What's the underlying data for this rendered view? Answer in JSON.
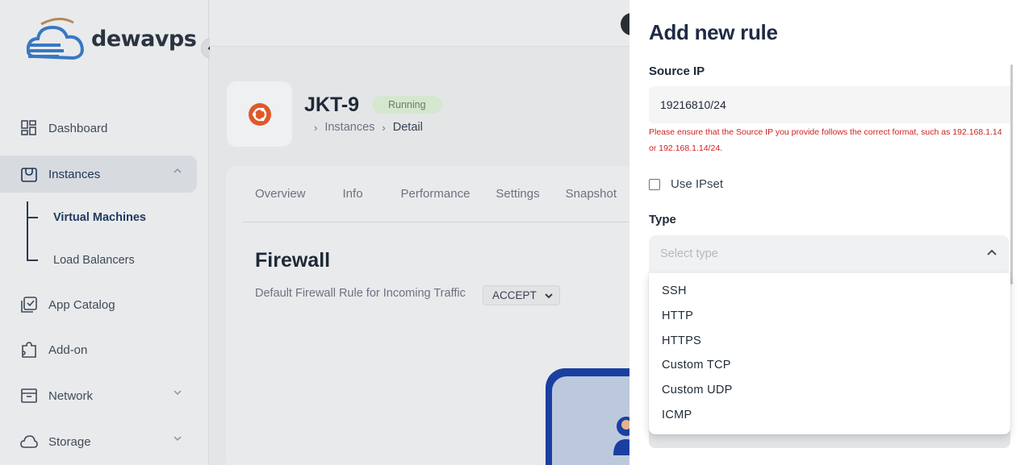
{
  "sidebar": {
    "brand": "dewavps",
    "items": [
      {
        "label": "Dashboard",
        "icon": "dashboard-icon"
      },
      {
        "label": "Instances",
        "icon": "instances-icon"
      },
      {
        "label": "App Catalog",
        "icon": "app-catalog-icon"
      },
      {
        "label": "Add-on",
        "icon": "puzzle-icon"
      },
      {
        "label": "Network",
        "icon": "network-icon"
      },
      {
        "label": "Storage",
        "icon": "cloud-icon"
      }
    ],
    "subitems": [
      {
        "label": "Virtual Machines"
      },
      {
        "label": "Load Balancers"
      }
    ]
  },
  "instance": {
    "name": "JKT-9",
    "status": "Running",
    "breadcrumb": [
      "Instances",
      "Detail"
    ]
  },
  "tabs": [
    "Overview",
    "Info",
    "Performance",
    "Settings",
    "Snapshot"
  ],
  "firewall": {
    "title": "Firewall",
    "default_label": "Default Firewall Rule for Incoming Traffic",
    "default_value": "ACCEPT"
  },
  "drawer": {
    "title": "Add new rule",
    "source_ip_label": "Source IP",
    "source_ip_value": "19216810/24",
    "source_ip_error": "Please ensure that the Source IP you provide follows the correct format, such as 192.168.1.14 or 192.168.1.14/24.",
    "use_ipset_label": "Use IPset",
    "type_label": "Type",
    "type_placeholder": "Select type",
    "type_options": [
      "SSH",
      "HTTP",
      "HTTPS",
      "Custom TCP",
      "Custom UDP",
      "ICMP"
    ]
  },
  "colors": {
    "error": "#d21f1f",
    "running_badge": "#d4e7cf",
    "active_nav": "#d7dadf",
    "brand_blue": "#1a3fa1"
  }
}
